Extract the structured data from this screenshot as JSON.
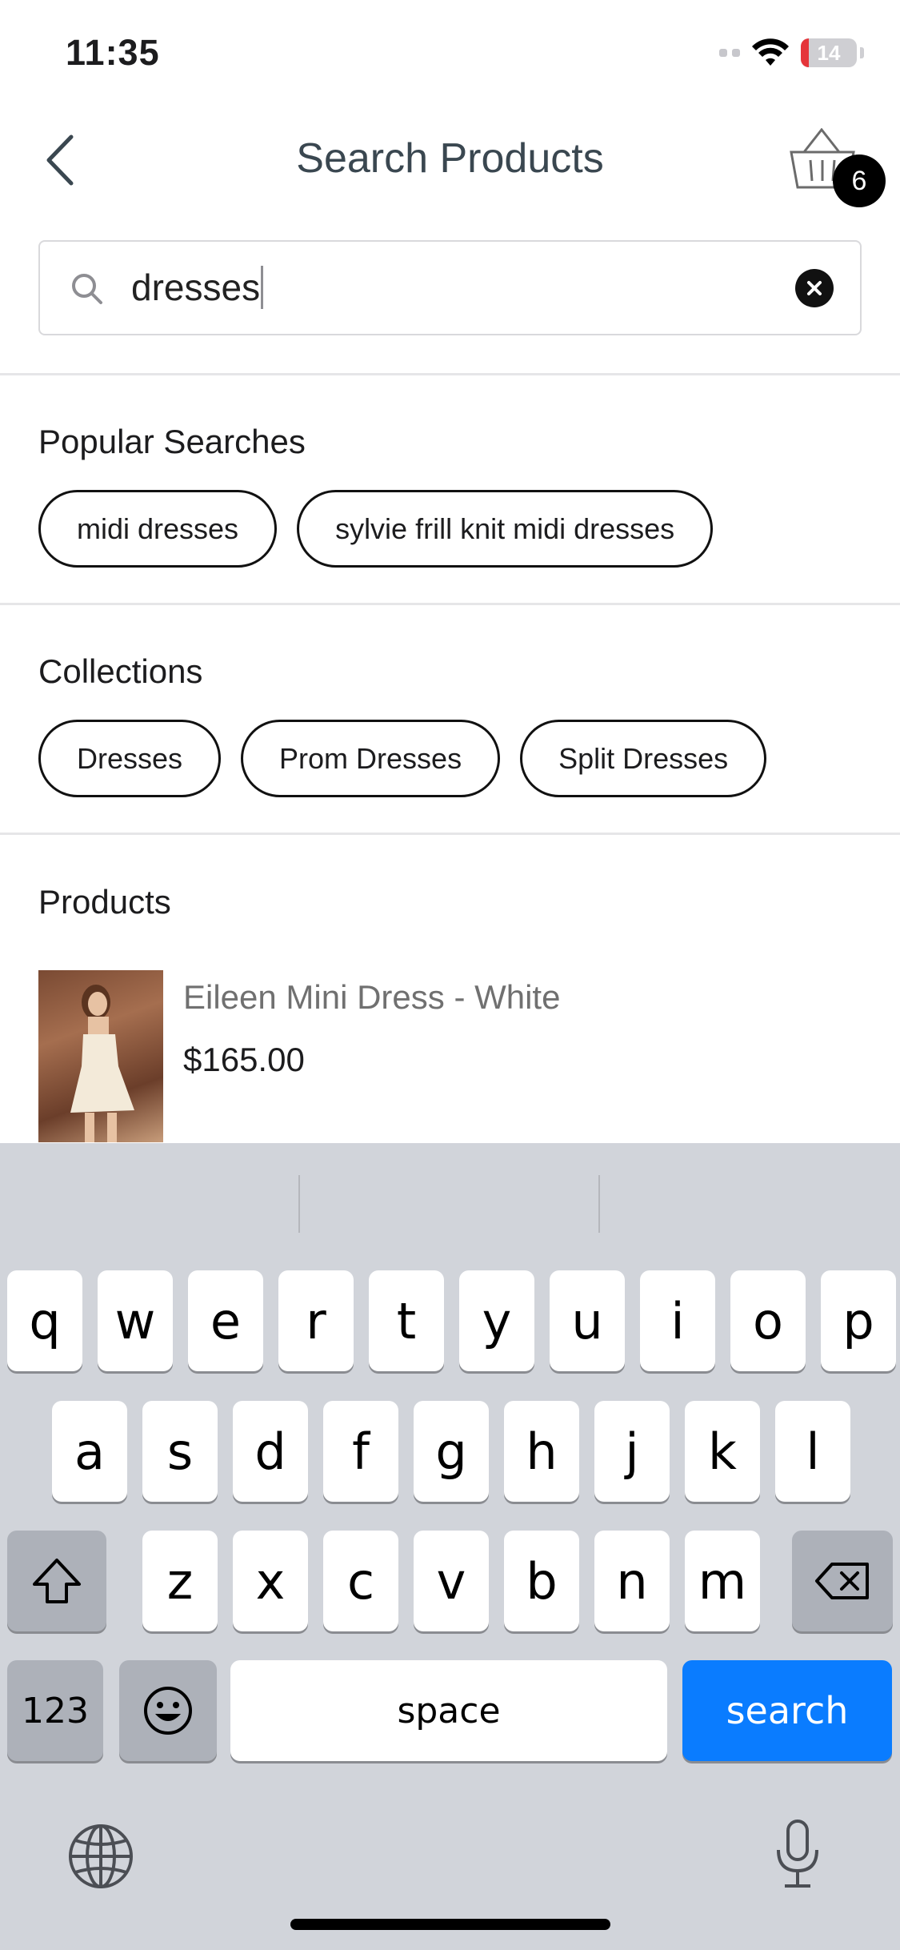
{
  "status_bar": {
    "time": "11:35",
    "battery_level": "14",
    "battery_fraction": 0.14,
    "battery_color": "#e5353a"
  },
  "header": {
    "title": "Search Products",
    "cart_count": "6",
    "back_icon": "chevron-left-icon",
    "cart_icon": "basket-icon"
  },
  "search": {
    "value": "dresses",
    "icon": "search-icon",
    "clear_icon": "close-icon"
  },
  "popular": {
    "title": "Popular Searches",
    "items": [
      "midi dresses",
      "sylvie frill knit midi dresses"
    ]
  },
  "collections": {
    "title": "Collections",
    "items": [
      "Dresses",
      "Prom Dresses",
      "Split Dresses"
    ]
  },
  "products": {
    "title": "Products",
    "items": [
      {
        "name": "Eileen Mini Dress - White",
        "price": "$165.00"
      }
    ]
  },
  "keyboard": {
    "row1": [
      "q",
      "w",
      "e",
      "r",
      "t",
      "y",
      "u",
      "i",
      "o",
      "p"
    ],
    "row2": [
      "a",
      "s",
      "d",
      "f",
      "g",
      "h",
      "j",
      "k",
      "l"
    ],
    "row3": [
      "z",
      "x",
      "c",
      "v",
      "b",
      "n",
      "m"
    ],
    "numbers_label": "123",
    "space_label": "space",
    "action_label": "search",
    "action_color": "#0a7cff"
  }
}
